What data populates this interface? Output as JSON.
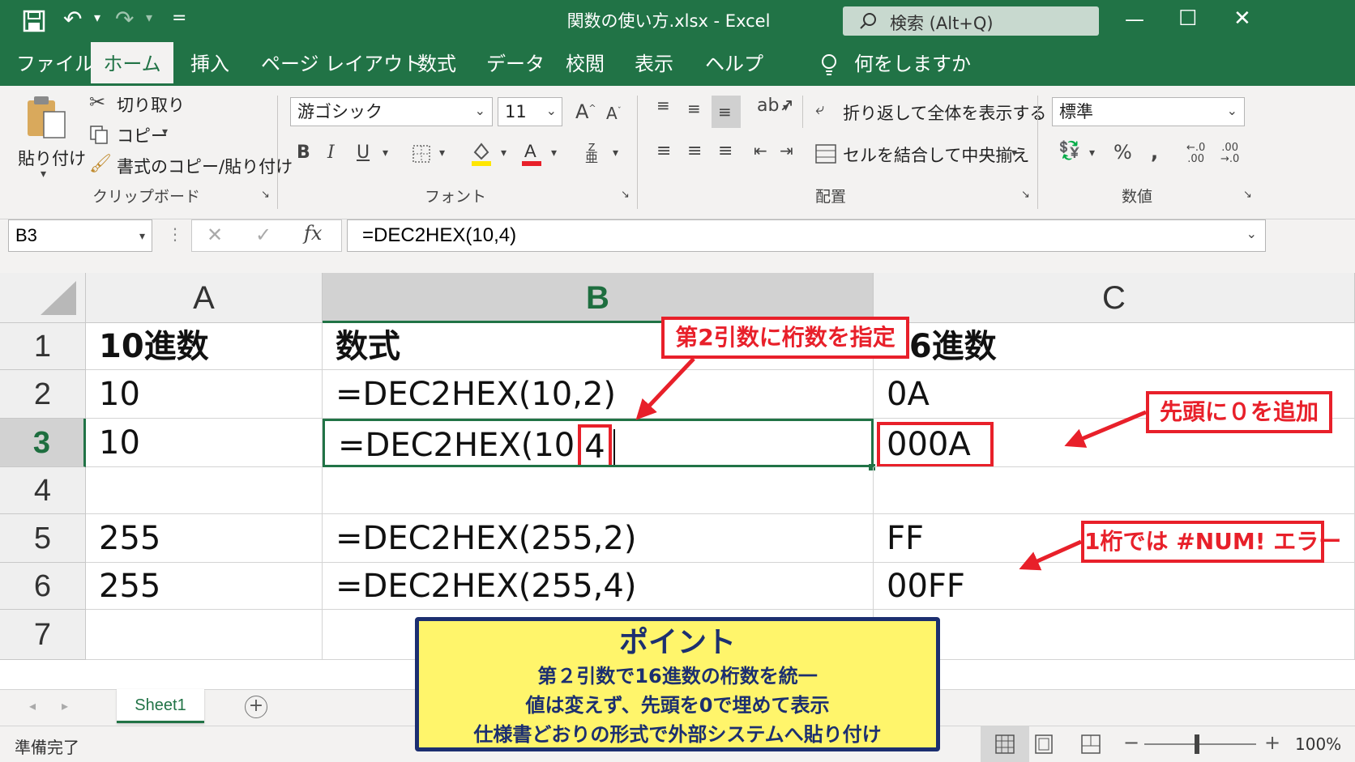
{
  "titlebar": {
    "title": "関数の使い方.xlsx  -  Excel",
    "search_placeholder": "検索 (Alt+Q)",
    "qat_more": "=",
    "window_minimize": "—",
    "window_restore": "☐",
    "window_close": "✕"
  },
  "tabs": [
    {
      "label": "ファイル"
    },
    {
      "label": "ホーム"
    },
    {
      "label": "挿入"
    },
    {
      "label": "ページ レイアウト"
    },
    {
      "label": "数式"
    },
    {
      "label": "データ"
    },
    {
      "label": "校閲"
    },
    {
      "label": "表示"
    },
    {
      "label": "ヘルプ"
    },
    {
      "label": "何をしますか"
    }
  ],
  "ribbon": {
    "clipboard": {
      "paste": "貼り付け",
      "cut": "切り取り",
      "copy": "コピー",
      "format_painter": "書式のコピー/貼り付け",
      "group_label": "クリップボード"
    },
    "font": {
      "font_name": "游ゴシック",
      "font_size": "11",
      "group_label": "フォント"
    },
    "alignment": {
      "wrap_text": "折り返して全体を表示する",
      "merge_center": "セルを結合して中央揃え",
      "group_label": "配置"
    },
    "number": {
      "format": "標準",
      "group_label": "数値"
    }
  },
  "formula_bar": {
    "name_box": "B3",
    "formula": "=DEC2HEX(10,4)"
  },
  "sheet": {
    "columns": [
      "A",
      "B",
      "C"
    ],
    "rows": [
      "1",
      "2",
      "3",
      "4",
      "5",
      "6",
      "7"
    ],
    "cells": {
      "A1": "10進数",
      "B1": "数式",
      "C1": "16進数",
      "A2": "10",
      "B2": "=DEC2HEX(10,2)",
      "C2": "0A",
      "A3": "10",
      "B3_prefix": "=DEC2HEX(10",
      "B3_arg": "4",
      "C3": "000A",
      "A5": "255",
      "B5": "=DEC2HEX(255,2)",
      "C5": "FF",
      "A6": "255",
      "B6": "=DEC2HEX(255,4)",
      "C6": "00FF"
    }
  },
  "annotations": {
    "digits_arg": "第2引数に桁数を指定",
    "leading_zero": "先頭に０を追加",
    "num_error": "1桁では #NUM! エラー",
    "point_title": "ポイント",
    "point_lines": [
      "第２引数で16進数の桁数を統一",
      "値は変えず、先頭を0で埋めて表示",
      "仕様書どおりの形式で外部システムへ貼り付け"
    ]
  },
  "sheet_tabs": [
    {
      "label": "Sheet1"
    }
  ],
  "status": {
    "ready": "準備完了",
    "zoom": "100%"
  },
  "colors": {
    "excel_green": "#217346",
    "callout_red": "#e8202a",
    "point_bg": "#fff56b",
    "point_border": "#1c2f70"
  }
}
